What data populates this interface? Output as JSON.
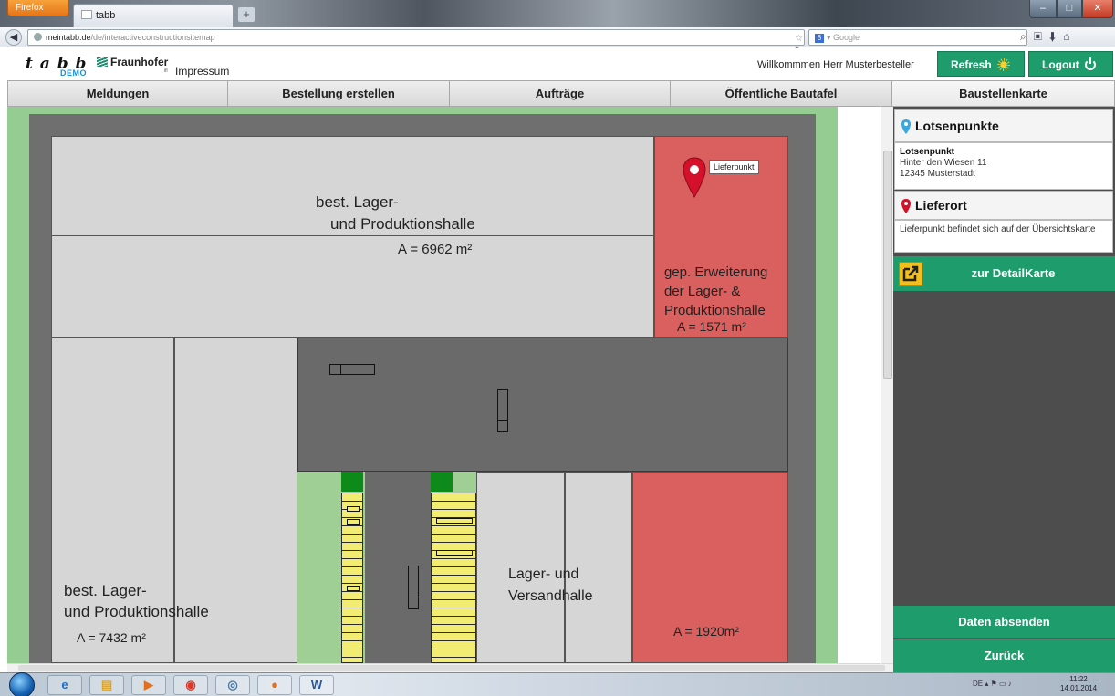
{
  "browser": {
    "app_button": "Firefox",
    "tab_title": "tabb",
    "new_tab": "+",
    "url_domain": "meintabb.de",
    "url_path": "/de/interactiveconstructionsitemap",
    "url_icons": "☆ ▾ C",
    "search_placeholder": "Google"
  },
  "header": {
    "logo": "t a b b",
    "logo_demo": "DEMO",
    "partner": "Fraunhofer",
    "partner_sub": "ifl",
    "impressum": "Impressum",
    "welcome": "Willkommmen Herr Musterbesteller",
    "refresh": "Refresh",
    "logout": "Logout"
  },
  "menu": [
    {
      "label": "Meldungen"
    },
    {
      "label": "Bestellung erstellen"
    },
    {
      "label": "Aufträge"
    },
    {
      "label": "Öffentliche Bautafel"
    },
    {
      "label": "Baustellenkarte"
    }
  ],
  "map": {
    "pin_label": "Lieferpunkt",
    "building_top": {
      "line1": "best. Lager-",
      "line2": "und Produktionshalle",
      "area": "A = 6962 m²"
    },
    "extension": {
      "line1": "gep. Erweiterung",
      "line2": "der Lager- &",
      "line3": "Produktionshalle",
      "area": "A = 1571 m²"
    },
    "building_left": {
      "line1": "best. Lager-",
      "line2": "und Produktionshalle",
      "area": "A = 7432 m²"
    },
    "versand": {
      "line1": "Lager- und",
      "line2": "Versandhalle"
    },
    "red_bottom": {
      "area": "A = 1920m²"
    },
    "colors": {
      "green": "#94cc92",
      "road": "#6f6f6f",
      "building": "#d6d6d6",
      "planned": "#d9605e",
      "stack": "#f2ec72"
    }
  },
  "panel": {
    "lotsen_title": "Lotsenpunkte",
    "lotsen_name": "Lotsenpunkt",
    "lotsen_street": "Hinter den Wiesen 11",
    "lotsen_city": "12345 Musterstadt",
    "lieferort_title": "Lieferort",
    "lieferort_text": "Lieferpunkt befindet sich auf der Übersichtskarte",
    "detail_button": "zur DetailKarte",
    "send_button": "Daten absenden",
    "back_button": "Zurück"
  },
  "taskbar": {
    "word_label": "W",
    "lang": "DE",
    "time": "11:22",
    "date": "14.01.2014"
  }
}
